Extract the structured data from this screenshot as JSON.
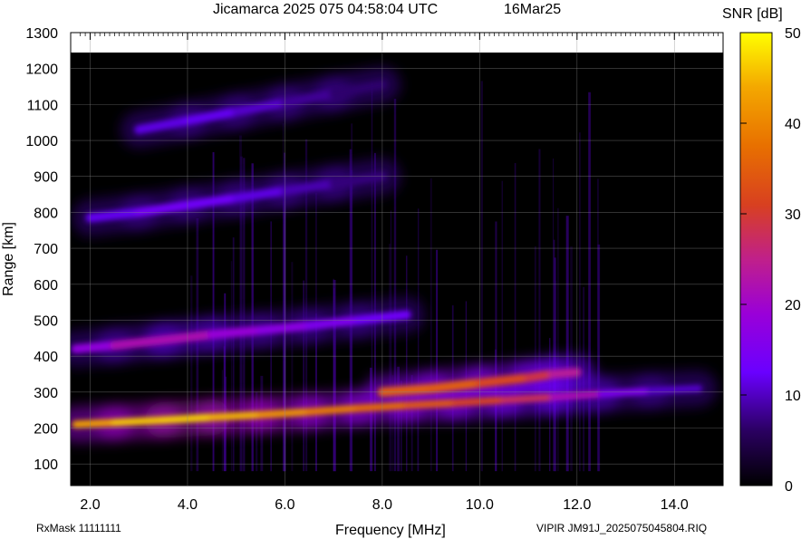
{
  "header": {
    "title": "Jicamarca 2025 075 04:58:04 UTC",
    "date": "16Mar25"
  },
  "footer": {
    "rxmask": "RxMask 11111111",
    "file": "VIPIR  JM91J_2025075045804.RIQ"
  },
  "colors": {
    "background": "#000000",
    "grid": "#888888",
    "colormap": [
      "#000000",
      "#1a0033",
      "#3b007a",
      "#5a00c8",
      "#7a00ff",
      "#a000ff",
      "#c0208a",
      "#d83a2a",
      "#e86000",
      "#f08800",
      "#f8b800",
      "#ffee00"
    ]
  },
  "chart_data": {
    "type": "heatmap",
    "title": "Jicamarca 2025 075 04:58:04 UTC",
    "xlabel": "Frequency [MHz]",
    "ylabel": "Range [km]",
    "xlim": [
      1.6,
      15.0
    ],
    "ylim": [
      40,
      1300
    ],
    "xticks": [
      2.0,
      4.0,
      6.0,
      8.0,
      10.0,
      12.0,
      14.0
    ],
    "xtick_labels": [
      "2.0",
      "4.0",
      "6.0",
      "8.0",
      "10.0",
      "12.0",
      "14.0"
    ],
    "yticks": [
      100,
      200,
      300,
      400,
      500,
      600,
      700,
      800,
      900,
      1000,
      1100,
      1200,
      1300
    ],
    "colorbar": {
      "label": "SNR [dB]",
      "range": [
        0,
        50
      ],
      "ticks": [
        0,
        10,
        20,
        30,
        40,
        50
      ]
    },
    "grid": true,
    "traces": [
      {
        "x": [
          1.7,
          2.5,
          3.5,
          4.5,
          5.5,
          6.5,
          7.5,
          8.5,
          9.5,
          10.5,
          11.5,
          12.5,
          13.5,
          14.5
        ],
        "y": [
          210,
          215,
          222,
          230,
          237,
          245,
          255,
          263,
          270,
          278,
          286,
          295,
          303,
          310
        ],
        "snr": [
          42,
          45,
          48,
          46,
          44,
          40,
          38,
          36,
          33,
          30,
          26,
          18,
          12,
          8
        ]
      },
      {
        "x": [
          8.0,
          9.0,
          10.0,
          11.0,
          11.5,
          12.0
        ],
        "y": [
          300,
          310,
          325,
          340,
          350,
          355
        ],
        "snr": [
          35,
          36,
          34,
          30,
          28,
          20
        ]
      },
      {
        "x": [
          1.7,
          2.5,
          3.5,
          4.5,
          5.5,
          6.5,
          7.5,
          8.5
        ],
        "y": [
          420,
          430,
          445,
          460,
          472,
          485,
          500,
          515
        ],
        "snr": [
          16,
          20,
          24,
          20,
          18,
          16,
          14,
          12
        ]
      },
      {
        "x": [
          2.0,
          3.0,
          4.0,
          5.0,
          6.0,
          7.0,
          8.0
        ],
        "y": [
          785,
          800,
          820,
          840,
          860,
          880,
          900
        ],
        "snr": [
          10,
          13,
          14,
          12,
          10,
          8,
          6
        ]
      },
      {
        "x": [
          3.0,
          4.0,
          5.0,
          6.0,
          7.0,
          8.0
        ],
        "y": [
          1030,
          1055,
          1080,
          1105,
          1130,
          1155
        ],
        "snr": [
          10,
          12,
          11,
          9,
          7,
          6
        ]
      }
    ]
  }
}
